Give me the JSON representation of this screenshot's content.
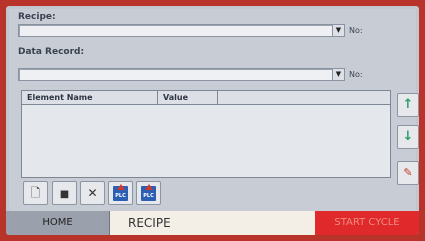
{
  "recipe": {
    "label": "Recipe:",
    "value": "",
    "no_label": "No:"
  },
  "data_record": {
    "label": "Data Record:",
    "value": "",
    "no_label": "No:"
  },
  "table": {
    "columns": [
      "Element Name",
      "Value",
      ""
    ]
  },
  "icons": {
    "dropdown": "chevron-down-icon",
    "move_up": "arrow-up-icon",
    "move_down": "arrow-down-icon",
    "edit": "edit-icon",
    "new": "new-document-icon",
    "save": "floppy-icon",
    "delete": "close-icon",
    "to_plc": "upload-to-plc-icon",
    "from_plc": "download-from-plc-icon"
  },
  "toolbar": {
    "plc_text": "PLC"
  },
  "nav": {
    "home": "HOME",
    "recipe": "RECIPE",
    "start_cycle": "START CYCLE"
  },
  "colors": {
    "frame": "#b8342a",
    "panel": "#c8ccd4",
    "arrow_accent": "#2f9e6e",
    "start_cycle": "#e0292b",
    "active_tab": "#f3efe6"
  }
}
